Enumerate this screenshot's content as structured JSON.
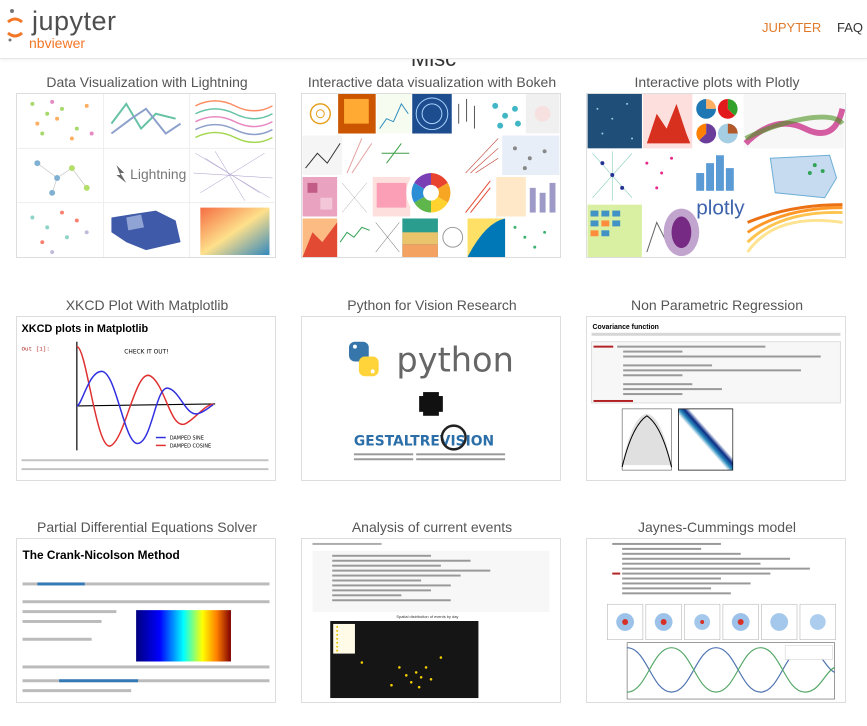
{
  "header": {
    "brand_word": "jupyter",
    "brand_sub": "nbviewer",
    "nav": [
      {
        "label": "JUPYTER",
        "color": "#e07a2b"
      },
      {
        "label": "FAQ",
        "color": "#333333"
      }
    ]
  },
  "section": {
    "title": "Misc"
  },
  "cards": [
    {
      "title": "Data Visualization with Lightning",
      "thumb_text": "Lightning"
    },
    {
      "title": "Interactive data visualization with Bokeh"
    },
    {
      "title": "Interactive plots with Plotly",
      "thumb_text": "plotly"
    },
    {
      "title": "XKCD Plot With Matplotlib",
      "thumb_heading": "XKCD plots in Matplotlib",
      "thumb_prompt": "Out [1]:",
      "thumb_note": "CHECK IT OUT!",
      "thumb_legend": [
        "DAMPED SINE",
        "DAMPED COSINE"
      ]
    },
    {
      "title": "Python for Vision Research",
      "thumb_text": "python",
      "thumb_sub": "GESTALTREVISION"
    },
    {
      "title": "Non Parametric Regression",
      "thumb_heading": "Covariance function"
    },
    {
      "title": "Partial Differential Equations Solver",
      "thumb_heading": "The Crank-Nicolson Method"
    },
    {
      "title": "Analysis of current events",
      "thumb_heading": "Spatial distribution of events by day"
    },
    {
      "title": "Jaynes-Cummings model"
    }
  ]
}
